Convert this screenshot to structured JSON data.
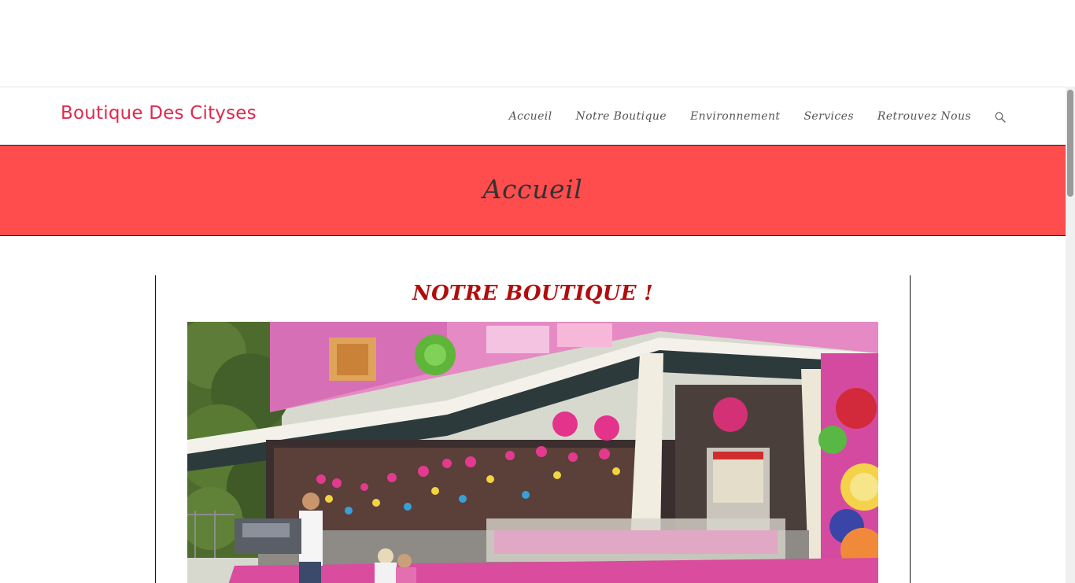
{
  "site": {
    "title": "Boutique Des Cityses"
  },
  "nav": {
    "items": [
      {
        "label": "Accueil"
      },
      {
        "label": "Notre Boutique"
      },
      {
        "label": "Environnement"
      },
      {
        "label": "Services"
      },
      {
        "label": "Retrouvez Nous"
      }
    ],
    "search_icon": "search-icon"
  },
  "hero": {
    "title": "Accueil",
    "background_color": "#ff4d4d"
  },
  "main": {
    "section_title": "NOTRE BOUTIQUE !",
    "section_title_color": "#b10d0d"
  },
  "colors": {
    "brand": "#e0284e",
    "nav_text": "#555555"
  }
}
